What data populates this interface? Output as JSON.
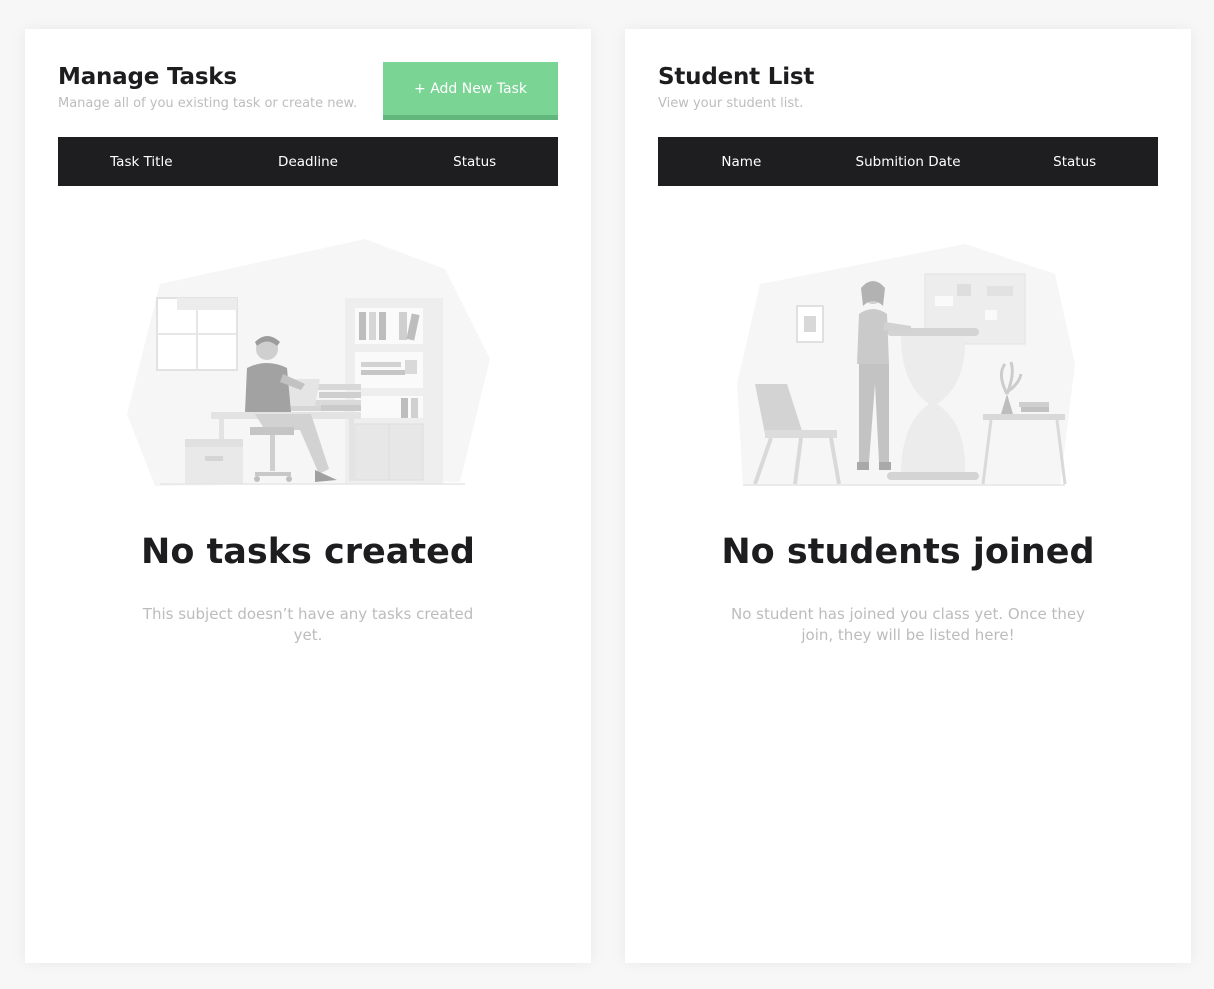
{
  "tasks_panel": {
    "title": "Manage Tasks",
    "subtitle": "Manage all of you existing task or create new.",
    "add_button_label": "+ Add New Task",
    "columns": [
      "Task Title",
      "Deadline",
      "Status"
    ],
    "empty_title": "No tasks created",
    "empty_description": "This subject doesn’t have any tasks created yet.",
    "illustration_icon": "office-desk-illustration"
  },
  "students_panel": {
    "title": "Student List",
    "subtitle": "View your student list.",
    "columns": [
      "Name",
      "Submition Date",
      "Status"
    ],
    "empty_title": "No students joined",
    "empty_description": "No student has joined you class yet. Once they join, they will be listed here!",
    "illustration_icon": "waiting-hourglass-illustration"
  },
  "colors": {
    "accent_green": "#7ad494",
    "table_header": "#1e1e20",
    "text_dark": "#1d1d1f",
    "text_muted": "#bcbcbc"
  }
}
